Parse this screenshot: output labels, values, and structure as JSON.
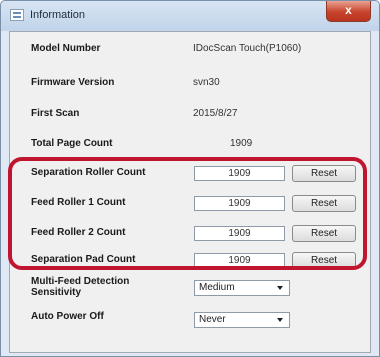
{
  "window": {
    "title": "Information",
    "close_label": "x"
  },
  "info": {
    "model_number_label": "Model Number",
    "model_number_value": "IDocScan Touch(P1060)",
    "firmware_label": "Firmware Version",
    "firmware_value": "svn30",
    "first_scan_label": "First Scan",
    "first_scan_value": "2015/8/27",
    "total_count_label": "Total Page Count",
    "total_count_value": "1909"
  },
  "counters": [
    {
      "label": "Separation Roller Count",
      "value": "1909",
      "reset_label": "Reset"
    },
    {
      "label": "Feed Roller 1 Count",
      "value": "1909",
      "reset_label": "Reset"
    },
    {
      "label": "Feed Roller 2 Count",
      "value": "1909",
      "reset_label": "Reset"
    },
    {
      "label": "Separation Pad Count",
      "value": "1909",
      "reset_label": "Reset"
    }
  ],
  "settings": {
    "multifeed_label_line1": "Multi-Feed Detection",
    "multifeed_label_line2": "Sensitivity",
    "multifeed_value": "Medium",
    "auto_power_label": "Auto Power Off",
    "auto_power_value": "Never"
  },
  "colors": {
    "highlight": "#c0152f",
    "close_button": "#c7432b"
  }
}
